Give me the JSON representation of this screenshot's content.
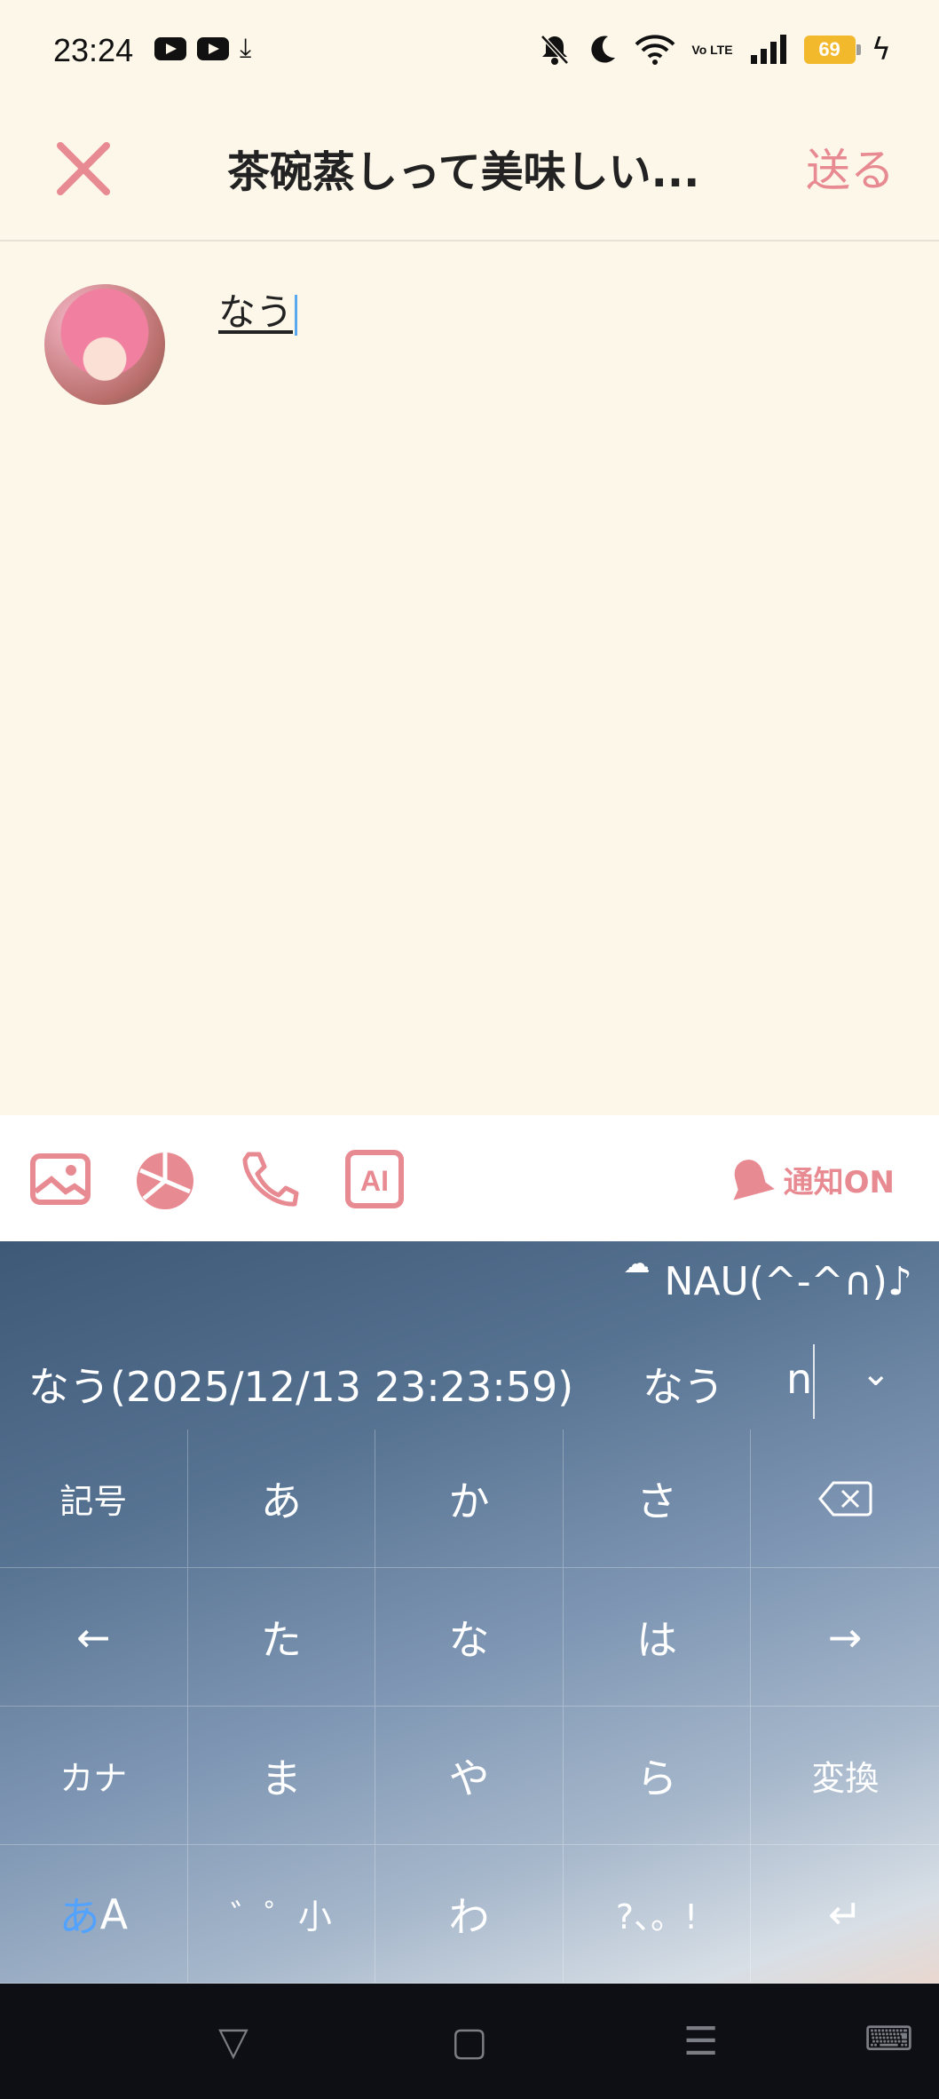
{
  "status_bar": {
    "time": "23:24",
    "volte": "Vo LTE",
    "battery": "69"
  },
  "header": {
    "title": "茶碗蒸しって美味しい...",
    "send_label": "送る"
  },
  "compose": {
    "text": "なう"
  },
  "toolbar": {
    "notify_label": "通知ON",
    "ai_label": "AI"
  },
  "keyboard": {
    "top_text": "NAU(^-^∩)♪",
    "suggestions": [
      "なう(2025/12/13 23:23:59)",
      "なう",
      "n"
    ],
    "keys": [
      "記号",
      "あ",
      "か",
      "さ",
      "⌫",
      "←",
      "た",
      "な",
      "は",
      "→",
      "カナ",
      "ま",
      "や",
      "ら",
      "変換",
      "あA",
      "゛゜小",
      "わ",
      "?、。!",
      "↵"
    ]
  },
  "colors": {
    "accent": "#e88a91",
    "background": "#fdf7e9"
  }
}
